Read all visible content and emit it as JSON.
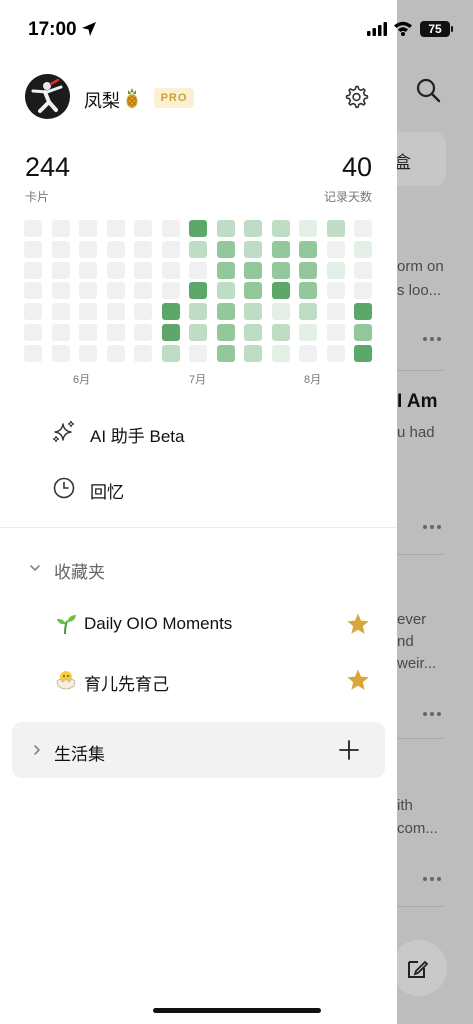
{
  "status_bar": {
    "time": "17:00",
    "battery": "75"
  },
  "profile": {
    "username": "凤梨",
    "badge": "PRO"
  },
  "stats": {
    "cards_value": "244",
    "cards_label": "卡片",
    "days_value": "40",
    "days_label": "记录天数"
  },
  "heatmap": {
    "colors": [
      "#f0f0f0",
      "#e4f0e6",
      "#bfdcc4",
      "#93c79c",
      "#5da76b"
    ],
    "levels": [
      [
        0,
        0,
        0,
        0,
        0,
        0,
        4,
        2,
        2,
        2,
        1,
        2,
        0
      ],
      [
        0,
        0,
        0,
        0,
        0,
        0,
        2,
        3,
        2,
        3,
        3,
        0,
        1
      ],
      [
        0,
        0,
        0,
        0,
        0,
        0,
        0,
        3,
        3,
        3,
        3,
        1,
        0
      ],
      [
        0,
        0,
        0,
        0,
        0,
        0,
        4,
        2,
        3,
        4,
        3,
        0,
        0
      ],
      [
        0,
        0,
        0,
        0,
        0,
        4,
        2,
        3,
        2,
        1,
        2,
        0,
        4
      ],
      [
        0,
        0,
        0,
        0,
        0,
        4,
        2,
        3,
        2,
        2,
        1,
        0,
        3
      ],
      [
        0,
        0,
        0,
        0,
        0,
        2,
        0,
        3,
        2,
        1,
        0,
        0,
        4
      ]
    ],
    "months": [
      "6月",
      "7月",
      "8月"
    ]
  },
  "menu": {
    "ai_label": "AI 助手 Beta",
    "memories_label": "回忆"
  },
  "favorites": {
    "section_label": "收藏夹",
    "items": [
      {
        "label": "Daily OIO Moments",
        "icon": "seedling-icon"
      },
      {
        "label": "育儿先育己",
        "icon": "hatching-chick-icon"
      }
    ]
  },
  "collections": {
    "label": "生活集"
  },
  "background": {
    "chip_text": "盒",
    "lines": [
      "orm on",
      "s loo...",
      "I Am",
      "u had",
      "ever",
      "nd",
      "weir...",
      "ith",
      "com..."
    ]
  },
  "colors": {
    "star": "#d8a63a",
    "pro_bg": "#fbf0cf",
    "pro_text": "#c9a23a"
  }
}
